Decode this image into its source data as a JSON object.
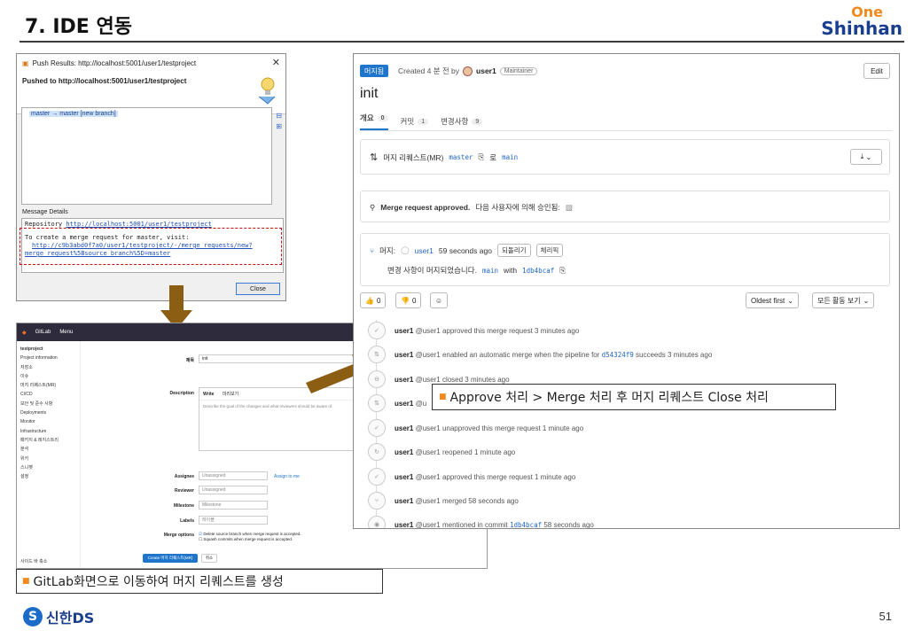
{
  "slide": {
    "title": "7. IDE 연동",
    "logo_one": "One",
    "logo_shinhan": "Shinhan",
    "footer_logo_text": "신한DS",
    "page_number": "51"
  },
  "push_dialog": {
    "window_title": "Push Results: http://localhost:5001/user1/testproject",
    "heading": "Pushed to http://localhost:5001/user1/testproject",
    "ref_update": "master → master [new branch]",
    "message_label": "Message Details",
    "repo_line_label": "Repository",
    "repo_url": "http://localhost:5001/user1/testproject",
    "mr_intro": "To create a merge request for master, visit:",
    "mr_url_1": "http://c9b3abd0f7a0/user1/testproject/-/merge_requests/new?",
    "mr_url_2": "merge_request%5Bsource_branch%5D=master",
    "close_label": "Close"
  },
  "gitlab_form": {
    "brand": "GitLab",
    "menu": "Menu",
    "project": "testproject",
    "sidebar": [
      "Project information",
      "저장소",
      "이슈",
      "머지 리퀘스트(MR)",
      "CI/CD",
      "보안 및 준수 사항",
      "Deployments",
      "Monitor",
      "Infrastructure",
      "패키지 & 레지스트리",
      "분석",
      "위키",
      "스니펫",
      "설정"
    ],
    "collapse": "사이드 바 축소",
    "title_label": "제목",
    "title_value": "init",
    "desc_label": "Description",
    "write_tab": "Write",
    "preview_tab": "미리보기",
    "desc_placeholder": "Describe the goal of the changes and what reviewers should be aware of.",
    "assignee_label": "Assignee",
    "assignee_value": "Unassigned",
    "assign_me": "Assign to me",
    "reviewer_label": "Reviewer",
    "reviewer_value": "Unassigned",
    "milestone_label": "Milestone",
    "milestone_value": "Milestone",
    "labels_label": "Labels",
    "labels_value": "레이블",
    "merge_options_label": "Merge options",
    "opt_delete": "Delete source branch when merge request is accepted.",
    "opt_squash": "Squash commits when merge request is accepted.",
    "create_btn": "Create 머지 리퀘스트(MR)",
    "cancel_btn": "취소"
  },
  "caption_left": "GitLab화면으로 이동하여 머지 리퀘스트를 생성",
  "mr_panel": {
    "status_badge": "머지됨",
    "created": "Created 4 분 전 by",
    "author": "user1",
    "role": "Maintainer",
    "edit": "Edit",
    "title": "init",
    "tabs": [
      {
        "label": "개요",
        "count": "0"
      },
      {
        "label": "커밋",
        "count": "1"
      },
      {
        "label": "변경사항",
        "count": "9"
      }
    ],
    "mr_line_label": "머지 리퀘스트(MR)",
    "source_branch": "master",
    "to_label": "로",
    "target_branch": "main",
    "approved_bold": "Merge request approved.",
    "approved_rest": "다음 사용자에 의해 승인됨:",
    "merged_label": "머지:",
    "merged_by": "user1",
    "merged_time": "59 seconds ago",
    "revert_btn": "되돌리기",
    "cherry_btn": "체리픽",
    "merged_desc": "변경 사항이 머지되었습니다.",
    "merged_branch": "main",
    "with_label": "with",
    "merged_commit": "1db4bcaf",
    "thumbs_up": "0",
    "thumbs_down": "0",
    "sort": "Oldest first",
    "filter": "모든 활동 보기",
    "activities": [
      {
        "user": "user1",
        "text": "@user1 approved this merge request 3 minutes ago"
      },
      {
        "user": "user1",
        "text": "@user1 enabled an automatic merge when the pipeline for",
        "commit": "d54324f9",
        "tail": "succeeds 3 minutes ago"
      },
      {
        "user": "user1",
        "text": "@user1 closed 3 minutes ago"
      },
      {
        "user": "user1",
        "text": "@u"
      },
      {
        "user": "user1",
        "text": "@user1 unapproved this merge request 1 minute ago"
      },
      {
        "user": "user1",
        "text": "@user1 reopened 1 minute ago"
      },
      {
        "user": "user1",
        "text": "@user1 approved this merge request 1 minute ago"
      },
      {
        "user": "user1",
        "text": "@user1 merged 58 seconds ago"
      },
      {
        "user": "user1",
        "text": "@user1 mentioned in commit",
        "commit": "1db4bcaf",
        "tail": "58 seconds ago"
      }
    ]
  },
  "callout": "Approve 처리 > Merge 처리 후 머지 리퀘스트 Close 처리",
  "colors": {
    "accent_blue": "#1f75cb",
    "brand_orange": "#f08a1e",
    "brand_navy": "#1b3f8f",
    "arrow_brown": "#8b5e14",
    "dashed_red": "#c81010"
  }
}
